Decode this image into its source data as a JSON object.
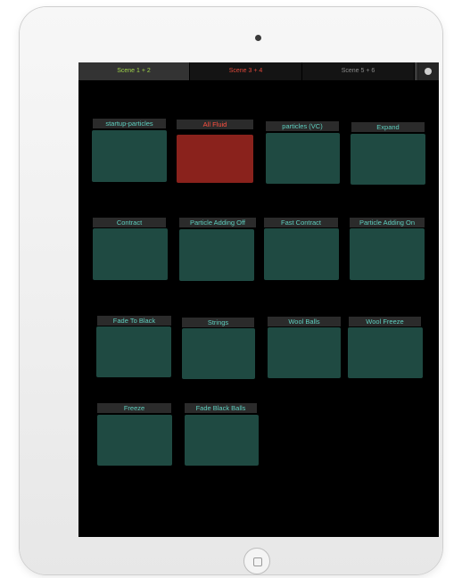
{
  "tabs": [
    {
      "label": "Scene 1 + 2",
      "color": "#9fd34a"
    },
    {
      "label": "Scene 3 + 4",
      "color": "#e0483a"
    },
    {
      "label": "Scene 5 + 6",
      "color": "#8a8a8a"
    }
  ],
  "colors": {
    "pad_fill": "#1f4a42",
    "pad_active_fill": "#8a221c",
    "label_text": "#5fd0c0",
    "label_active_text": "#ff5040"
  },
  "pads": [
    {
      "label": "startup-particles",
      "active": false
    },
    {
      "label": "All Fluid",
      "active": true
    },
    {
      "label": "particles (VC)",
      "active": false
    },
    {
      "label": "Expand",
      "active": false
    },
    {
      "label": "Contract",
      "active": false
    },
    {
      "label": "Particle Adding Off",
      "active": false
    },
    {
      "label": "Fast Contract",
      "active": false
    },
    {
      "label": "Particle Adding On",
      "active": false
    },
    {
      "label": "Fade To Black",
      "active": false
    },
    {
      "label": "Strings",
      "active": false
    },
    {
      "label": "Wool Balls",
      "active": false
    },
    {
      "label": "Wool Freeze",
      "active": false
    },
    {
      "label": "Freeze",
      "active": false
    },
    {
      "label": "Fade Black Balls",
      "active": false
    }
  ]
}
